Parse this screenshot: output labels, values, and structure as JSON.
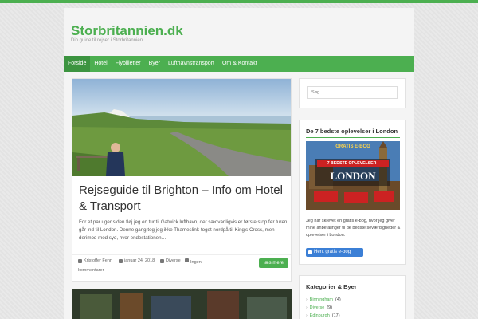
{
  "site": {
    "title": "Storbritannien.dk",
    "tagline": "Din guide til rejser i Storbritannien"
  },
  "nav": [
    {
      "label": "Forside",
      "active": true
    },
    {
      "label": "Hotel",
      "active": false
    },
    {
      "label": "Flybilletter",
      "active": false
    },
    {
      "label": "Byer",
      "active": false
    },
    {
      "label": "Lufthavnstransport",
      "active": false
    },
    {
      "label": "Om & Kontakt",
      "active": false
    }
  ],
  "post": {
    "title": "Rejseguide til Brighton – Info om Hotel & Transport",
    "excerpt": "For et par uger siden fløj jeg en tur til Gatwick lufthavn, der sædvanligvis er første stop før turen går ind til London. Denne gang tog jeg ikke Thameslink-toget nordpå til King's Cross, men derimod mod syd, hvor endestationen…",
    "author": "Kristoffer Fenn",
    "date": "januar 24, 2018",
    "category": "Diverse",
    "comments": "Ingen kommentarer",
    "read_more": "læs mere"
  },
  "sidebar": {
    "search_placeholder": "Søg",
    "widget1_title": "De 7 bedste oplevelser i London",
    "banner_line1": "GRATIS E-BOG",
    "banner_line2": "7 BEDSTE OPLEVELSER I",
    "banner_line3": "LONDON",
    "widget1_text": "Jeg har skrevet en gratis e-bog, hvor jeg giver mine anbefalinger til de bedste seværdigheder & oplevelser i London.",
    "widget1_button": "Hent gratis e-bog",
    "widget2_title": "Kategorier & Byer",
    "categories": [
      {
        "name": "Birmingham",
        "count": "(4)"
      },
      {
        "name": "Diverse",
        "count": "(9)"
      },
      {
        "name": "Edinburgh",
        "count": "(17)"
      }
    ]
  },
  "colors": {
    "accent": "#4caf50",
    "button_blue": "#3b7fd6"
  }
}
